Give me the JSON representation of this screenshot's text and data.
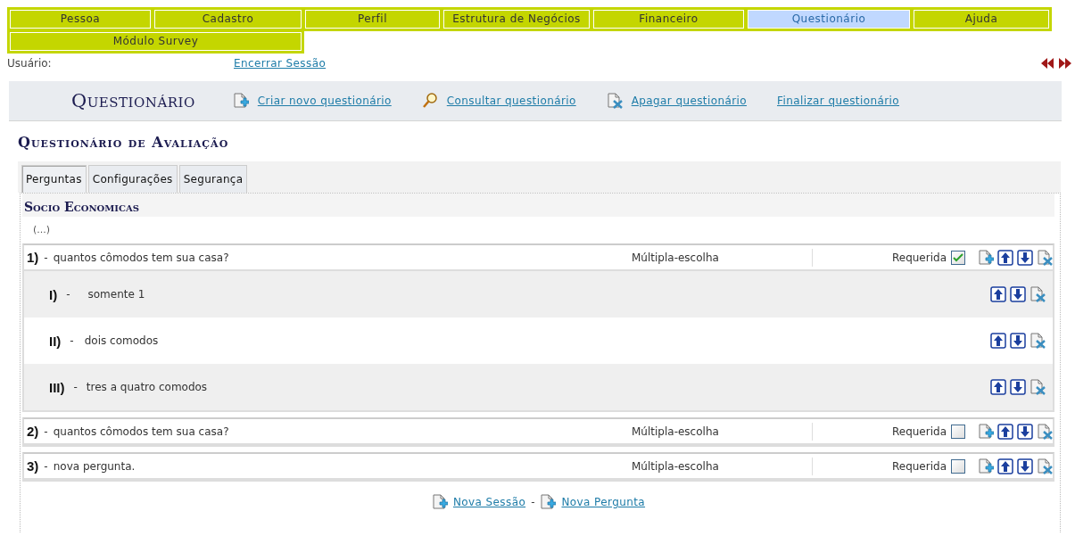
{
  "menu": [
    {
      "label": "Pessoa",
      "selected": false
    },
    {
      "label": "Cadastro",
      "selected": false
    },
    {
      "label": "Perfil",
      "selected": false
    },
    {
      "label": "Estrutura de Negócios",
      "selected": false
    },
    {
      "label": "Financeiro",
      "selected": false
    },
    {
      "label": "Questionário",
      "selected": true
    },
    {
      "label": "Ajuda",
      "selected": false
    },
    {
      "label": "Módulo Survey",
      "selected": false
    }
  ],
  "user_label": "Usuário:",
  "logout": "Encerrar Sessão",
  "header": {
    "title": "Questionário",
    "actions": [
      {
        "kind": "create",
        "label": "Criar novo questionário"
      },
      {
        "kind": "search",
        "label": "Consultar questionário"
      },
      {
        "kind": "delete",
        "label": "Apagar questionário"
      },
      {
        "kind": "finish",
        "label": "Finalizar questionário"
      }
    ]
  },
  "subtitle": "Questionário de Avaliação",
  "tabs": [
    {
      "label": "Perguntas",
      "selected": true
    },
    {
      "label": "Configurações",
      "selected": false
    },
    {
      "label": "Segurança",
      "selected": false
    }
  ],
  "section": {
    "title": "Socio Economicas",
    "note": "(...)"
  },
  "questions": [
    {
      "number": "1)",
      "dash": "-",
      "text": "quantos cômodos tem sua casa?",
      "type": "Múltipla-escolha",
      "required_label": "Requerida",
      "required": true,
      "options": [
        {
          "number": "I)",
          "dash": "-",
          "text": "somente 1"
        },
        {
          "number": "II)",
          "dash": "-",
          "text": "dois comodos"
        },
        {
          "number": "III)",
          "dash": "-",
          "text": "tres a quatro comodos"
        }
      ]
    },
    {
      "number": "2)",
      "dash": "-",
      "text": "quantos cômodos tem sua casa?",
      "type": "Múltipla-escolha",
      "required_label": "Requerida",
      "required": false
    },
    {
      "number": "3)",
      "dash": "-",
      "text": "nova pergunta.",
      "type": "Múltipla-escolha",
      "required_label": "Requerida",
      "required": false
    }
  ],
  "footer": {
    "links": [
      "Nova Sessão",
      "Nova Pergunta"
    ],
    "separator": "-"
  }
}
